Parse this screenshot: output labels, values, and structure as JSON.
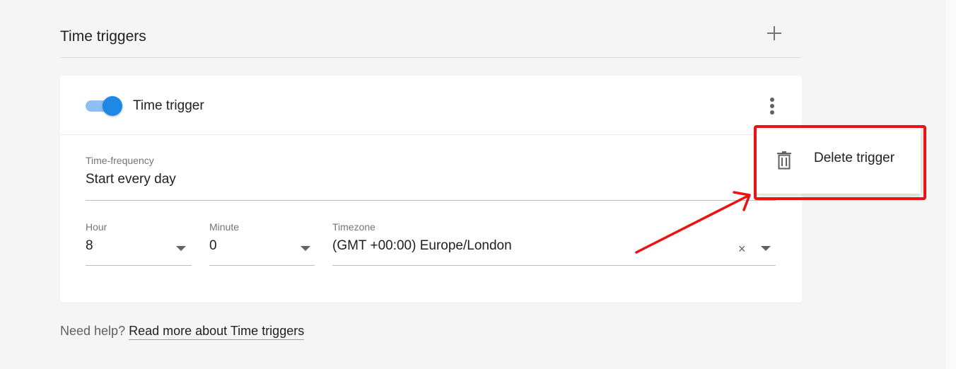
{
  "section": {
    "title": "Time triggers",
    "add_icon": "plus-icon"
  },
  "trigger": {
    "enabled": true,
    "title": "Time trigger",
    "more_icon": "more-vertical-icon"
  },
  "fields": {
    "frequency": {
      "label": "Time-frequency",
      "value": "Start every day"
    },
    "hour": {
      "label": "Hour",
      "value": "8"
    },
    "minute": {
      "label": "Minute",
      "value": "0"
    },
    "timezone": {
      "label": "Timezone",
      "value": "(GMT +00:00) Europe/London",
      "clear_glyph": "×"
    }
  },
  "help": {
    "text": "Need help?",
    "link": "Read more about Time triggers"
  },
  "menu": {
    "items": [
      {
        "icon": "trash-icon",
        "label": "Delete trigger"
      }
    ]
  },
  "annotation": {
    "highlight_color": "#ee1111",
    "arrow_color": "#ee1111"
  },
  "colors": {
    "toggle_thumb": "#1e88e5",
    "toggle_track": "#8ebff3"
  }
}
